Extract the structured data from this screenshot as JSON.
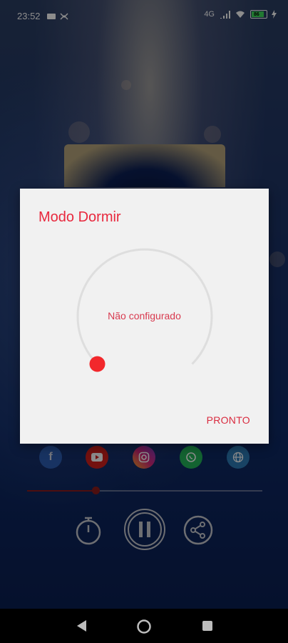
{
  "status_bar": {
    "time": "23:52",
    "network": "4G",
    "battery": "86"
  },
  "dialog": {
    "title": "Modo Dormir",
    "timer_status": "Não configurado",
    "timer_fraction": 0,
    "done_button": "PRONTO"
  },
  "player": {
    "progress_fraction": 0.29
  },
  "socials": [
    "facebook-icon",
    "youtube-icon",
    "instagram-icon",
    "whatsapp-icon",
    "globe-icon"
  ],
  "colors": {
    "accent": "#e8283d",
    "dialog_bg": "#f1f1f1",
    "dial_track": "#dedede"
  }
}
